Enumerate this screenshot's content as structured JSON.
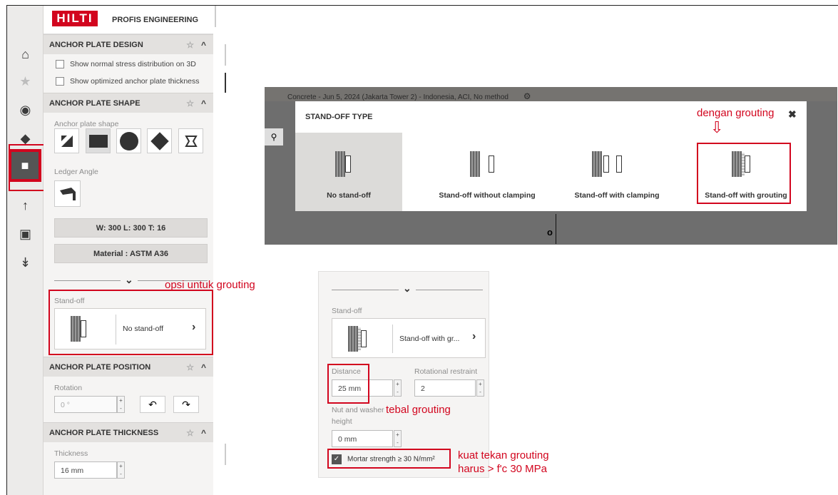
{
  "app": {
    "logo": "HILTI",
    "product": "PROFIS ENGINEERING"
  },
  "sidebar_icons": [
    "home-icon",
    "star-icon",
    "bulb-icon",
    "box-icon",
    "anchor-plate-icon",
    "anchor-icon",
    "profile-icon",
    "loads-icon"
  ],
  "sections": {
    "design": {
      "title": "ANCHOR PLATE DESIGN",
      "chk1": "Show normal stress distribution on 3D",
      "chk2": "Show optimized anchor plate thickness"
    },
    "shape": {
      "title": "ANCHOR PLATE SHAPE",
      "shape_label": "Anchor plate shape",
      "ledger_label": "Ledger Angle",
      "dims_button": "W: 300 L: 300 T: 16",
      "material_button": "Material : ASTM A36",
      "standoff_label": "Stand-off",
      "standoff_value": "No stand-off"
    },
    "position": {
      "title": "ANCHOR PLATE POSITION",
      "rotation_label": "Rotation",
      "rotation_value": "0 °"
    },
    "thickness": {
      "title": "ANCHOR PLATE THICKNESS",
      "thickness_label": "Thickness",
      "thickness_value": "16 mm"
    }
  },
  "project_bar": "Concrete - Jun 5, 2024 (Jakarta Tower 2) - Indonesia, ACI, No method",
  "dialog": {
    "title": "STAND-OFF TYPE",
    "options": [
      "No stand-off",
      "Stand-off without clamping",
      "Stand-off with clamping",
      "Stand-off with grouting"
    ]
  },
  "panel2": {
    "standoff_label": "Stand-off",
    "standoff_value": "Stand-off with gr...",
    "distance_label": "Distance",
    "distance_value": "25 mm",
    "rot_restraint_label": "Rotational restraint",
    "rot_restraint_value": "2",
    "nut_label_1": "Nut and washer",
    "nut_label_2": "height",
    "nut_value": "0 mm",
    "mortar": "Mortar strength ≥ 30 N/mm²"
  },
  "annotations": {
    "grouting_option": "opsi untuk grouting",
    "with_grouting": "dengan grouting",
    "thickness": "tebal grouting",
    "strength_1": "kuat tekan grouting",
    "strength_2": "harus > f'c 30 MPa"
  },
  "colors": {
    "accent": "#d2051e",
    "panel": "#f5f4f3",
    "header": "#e3e1df"
  }
}
